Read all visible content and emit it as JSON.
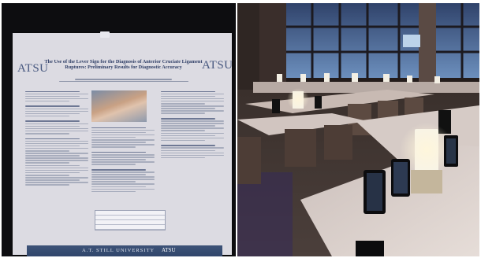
{
  "left_photo": {
    "poster": {
      "logo_left": "ATSU",
      "logo_right": "ATSU",
      "title": "The Use of the Lever Sign for the Diagnosis of Anterior Cruciate Ligament Ruptures: Preliminary Results for Diagnostic Accuracy",
      "footer_university": "A.T. STILL UNIVERSITY",
      "footer_logo": "ATSU"
    }
  },
  "right_photo": {
    "scene": "airport-terminal-seating-with-tablets",
    "colors": {
      "window_blue": "#4f6f9c",
      "lamp_white": "#f7f3e8",
      "table_top": "#d9cfc9"
    }
  }
}
